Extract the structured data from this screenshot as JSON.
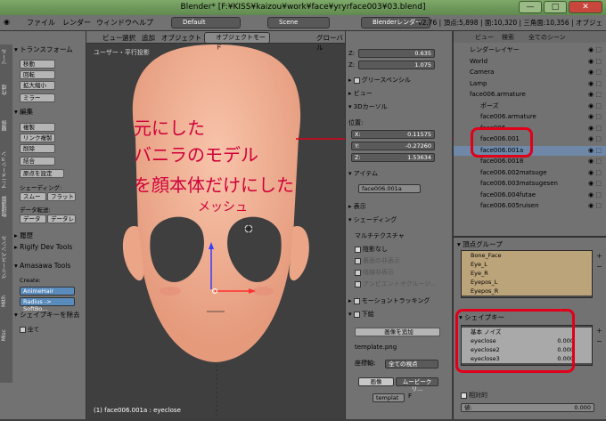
{
  "window": {
    "title": "Blender* [F:¥KISS¥kaizou¥work¥face¥yryrface003¥03.blend]"
  },
  "menubar": {
    "items": [
      "ファイル",
      "レンダー",
      "ウィンドウ",
      "ヘルプ"
    ],
    "layout": "Default",
    "scene": "Scene",
    "engine": "Blenderレンダー",
    "stats": "v2.76 | 頂点:5,898 | 面:10,320 | 三角面:10,356 | オブジェ"
  },
  "toolshelf": {
    "tabs": [
      "ツール",
      "作成",
      "関係",
      "アニメーション",
      "物理演算",
      "グリースペンシル",
      "Mith",
      "Misc"
    ],
    "transform_header": "トランスフォーム",
    "transform_buttons": [
      "移動",
      "回転",
      "拡大縮小",
      "ミラー"
    ],
    "edit_header": "編集",
    "edit_buttons": [
      "複製",
      "リンク複製",
      "削除",
      "結合"
    ],
    "origin_label": "原点を設定",
    "shading_label": "シェーディング:",
    "smooth": "スムー",
    "flat": "フラット",
    "data_transfer_label": "データ転送:",
    "data_btn": "データ",
    "data_layer_btn": "データレ",
    "history_header": "履歴",
    "rigify_header": "Rigify Dev Tools",
    "amasawa_header": "Amasawa Tools",
    "create_label": "Create:",
    "animehair_btn": "AnimeHair",
    "radius_btn": "Radius -> SoftBo...",
    "shapekey_header": "シェイプキーを除去",
    "all_label": "全て"
  },
  "viewport": {
    "menu": [
      "ビュー",
      "選択",
      "追加",
      "オブジェクト"
    ],
    "mode": "オブジェクトモード",
    "orientation": "グローバル",
    "view_label": "ユーザー・平行投影",
    "status": "(1) face006.001a : eyeclose"
  },
  "properties": {
    "z_label": "Z:",
    "z1_value": "0.635",
    "z2_value": "1.075",
    "grease": "グリースペンシル",
    "view": "ビュー",
    "cursor3d": "3Dカーソル",
    "location": "位置:",
    "x_label": "X:",
    "x_value": "0.11575",
    "y_label": "Y:",
    "y_value": "-0.27260",
    "cz_label": "Z:",
    "cz_value": "1.53634",
    "item": "アイテム",
    "item_name": "face006.001a",
    "display": "表示",
    "shading": "シェーディング",
    "multitexture": "マルチテクスチャ",
    "shadeless": "陰影なし",
    "backface": "裏面の非表示",
    "hidden_wire": "陰線非表示",
    "ambient": "アンビエントオクルージ...",
    "motion_tracking": "モーショントラッキング",
    "background": "下絵",
    "add_image": "画像を追加",
    "template_file": "template.png",
    "axis_label": "座標軸:",
    "axis_value": "全ての視点",
    "tab_image": "画像",
    "tab_movie": "ムービークリ...",
    "template_short": "templat",
    "f_label": "F"
  },
  "outliner": {
    "menu": [
      "ビュー",
      "検索",
      "全てのシーン"
    ],
    "rows": [
      {
        "label": "レンダーレイヤー",
        "selected": false
      },
      {
        "label": "World",
        "selected": false
      },
      {
        "label": "Camera",
        "selected": false
      },
      {
        "label": "Lamp",
        "selected": false
      },
      {
        "label": "face006.armature",
        "selected": false
      },
      {
        "label": "ポーズ",
        "selected": false
      },
      {
        "label": "face006.armature",
        "selected": false
      },
      {
        "label": "face006",
        "selected": false
      },
      {
        "label": "face006.001",
        "selected": false
      },
      {
        "label": "face006.001a",
        "selected": true
      },
      {
        "label": "face006.0018",
        "selected": false
      },
      {
        "label": "face006.002matsuge",
        "selected": false
      },
      {
        "label": "face006.003matsugesen",
        "selected": false
      },
      {
        "label": "face006.004futae",
        "selected": false
      },
      {
        "label": "face006.005ruisen",
        "selected": false
      }
    ]
  },
  "datapanel": {
    "vertex_groups_header": "頂点グループ",
    "vertex_groups": [
      "Bone_Face",
      "Eye_L",
      "Eye_R",
      "Eyepos_L",
      "Eyepos_R"
    ],
    "shapekeys_header": "シェイプキー",
    "shapekeys": [
      {
        "name": "基本 ノイズ",
        "value": ""
      },
      {
        "name": "eyeclose",
        "value": "0.000"
      },
      {
        "name": "eyeclose2",
        "value": "0.000"
      },
      {
        "name": "eyeclose3",
        "value": "0.000"
      }
    ],
    "relative": "相対的",
    "value_label": "値:",
    "value": "0.000"
  },
  "annotation": {
    "lines": [
      "元にした",
      "バニラのモデル",
      "を顔本体だけにした",
      "メッシュ"
    ]
  },
  "colors": {
    "annotation_red": "#e0001a",
    "skin": "#f4b49a",
    "selected_row": "#6f88a8"
  }
}
